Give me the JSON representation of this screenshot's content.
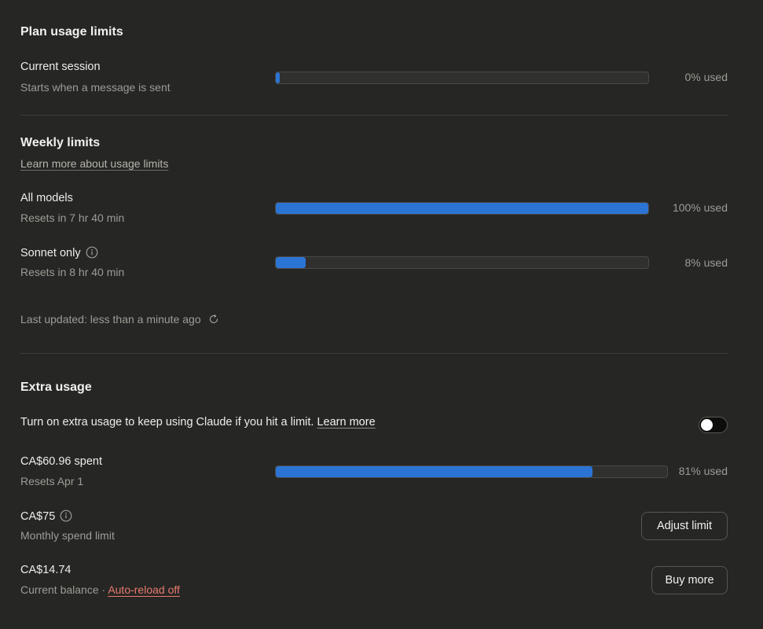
{
  "plan": {
    "title": "Plan usage limits",
    "session": {
      "label": "Current session",
      "sub": "Starts when a message is sent",
      "used_fraction": 0.01,
      "pct_label": "0% used"
    }
  },
  "weekly": {
    "title": "Weekly limits",
    "learn_more": "Learn more about usage limits",
    "all_models": {
      "label": "All models",
      "sub": "Resets in 7 hr 40 min",
      "used_fraction": 1.0,
      "pct_label": "100% used"
    },
    "sonnet": {
      "label": "Sonnet only",
      "sub": "Resets in 8 hr 40 min",
      "used_fraction": 0.08,
      "pct_label": "8% used"
    },
    "last_updated": "Last updated: less than a minute ago"
  },
  "extra": {
    "title": "Extra usage",
    "desc": "Turn on extra usage to keep using Claude if you hit a limit.",
    "learn_more": "Learn more",
    "toggle_on": false,
    "spent": {
      "label": "CA$60.96 spent",
      "sub": "Resets Apr 1",
      "used_fraction": 0.81,
      "pct_label": "81% used"
    },
    "limit": {
      "label": "CA$75",
      "sub": "Monthly spend limit",
      "button": "Adjust limit"
    },
    "balance": {
      "label": "CA$14.74",
      "sub": "Current balance",
      "separator": "·",
      "auto_reload": "Auto-reload off",
      "button": "Buy more"
    }
  },
  "colors": {
    "background": "#262624",
    "bar_fill": "#2c74d4",
    "link_red": "#e87a6e"
  }
}
